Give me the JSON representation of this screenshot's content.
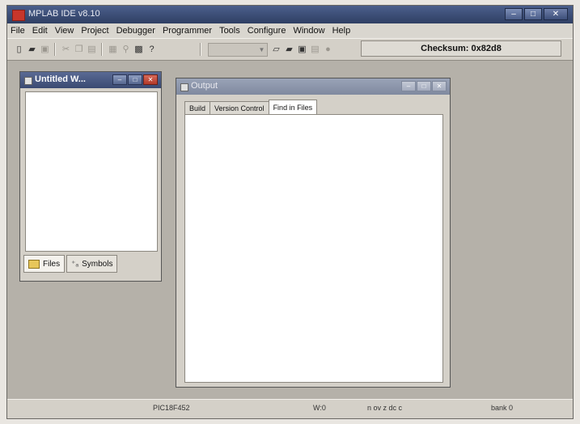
{
  "app": {
    "title": "MPLAB IDE v8.10"
  },
  "caption_buttons": {
    "minimize": "–",
    "maximize": "□",
    "close": "✕"
  },
  "menu": [
    "File",
    "Edit",
    "View",
    "Project",
    "Debugger",
    "Programmer",
    "Tools",
    "Configure",
    "Window",
    "Help"
  ],
  "toolbar": {
    "checksum": "Checksum: 0x82d8"
  },
  "workspace_window": {
    "title": "Untitled W...",
    "tabs": [
      {
        "label": "Files",
        "active": true
      },
      {
        "label": "Symbols",
        "active": false
      }
    ]
  },
  "output_window": {
    "title": "Output",
    "tabs": [
      {
        "label": "Build"
      },
      {
        "label": "Version Control"
      },
      {
        "label": "Find in Files",
        "active": true
      }
    ]
  },
  "status": {
    "device": "PIC18F452",
    "w_register": "W:0",
    "flags": "n ov z dc c",
    "bank": "bank 0"
  },
  "colors": {
    "active_title": "#3a4a72",
    "close_button": "#b23a2a",
    "workspace_bg": "#b5b1a9"
  }
}
